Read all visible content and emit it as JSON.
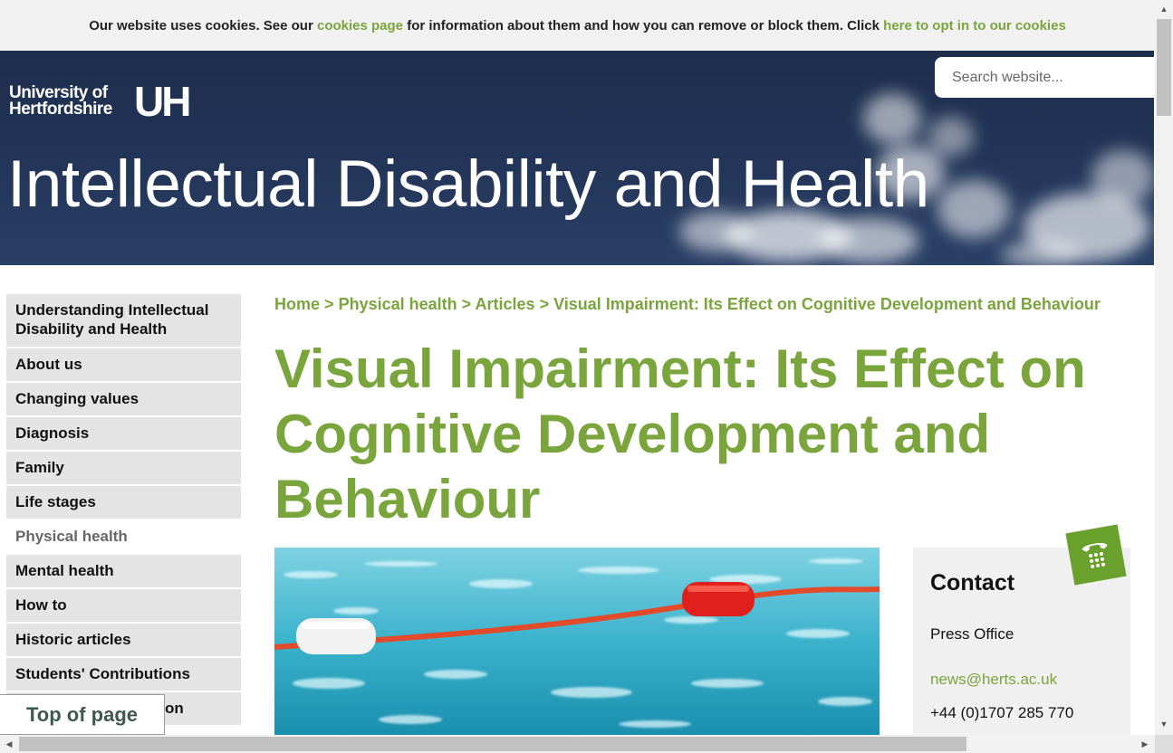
{
  "cookie": {
    "text1": "Our website uses cookies. See our",
    "link1": "cookies page",
    "text2": "for information about them and how you can remove or block them. Click",
    "link2": "here to opt in to our cookies"
  },
  "header": {
    "logo_line1": "University of",
    "logo_line2": "Hertfordshire",
    "logo_mark": "UH",
    "site_title": "Intellectual Disability and Health",
    "search_placeholder": "Search website..."
  },
  "sidebar": {
    "items": [
      {
        "label": "Understanding Intellectual Disability and Health"
      },
      {
        "label": "About us"
      },
      {
        "label": "Changing values"
      },
      {
        "label": "Diagnosis"
      },
      {
        "label": "Family"
      },
      {
        "label": "Life stages"
      },
      {
        "label": "Physical health"
      },
      {
        "label": "Mental health"
      },
      {
        "label": "How to"
      },
      {
        "label": "Historic articles"
      },
      {
        "label": "Students' Contributions"
      },
      {
        "label": "on"
      }
    ],
    "top_of_page": "Top of page"
  },
  "breadcrumb": {
    "items": [
      "Home",
      "Physical health",
      "Articles",
      "Visual Impairment: Its Effect on Cognitive Development and Behaviour"
    ],
    "separator": ">"
  },
  "page": {
    "title": "Visual Impairment: Its Effect on Cognitive Development and Behaviour"
  },
  "contact": {
    "heading": "Contact",
    "office": "Press Office",
    "email": "news@herts.ac.uk",
    "phone": "+44 (0)1707 285 770",
    "icon": "telephone-icon"
  },
  "colors": {
    "accent_green": "#7aa43c",
    "header_navy": "#1d2d4c",
    "badge_green": "#6aa12c"
  }
}
